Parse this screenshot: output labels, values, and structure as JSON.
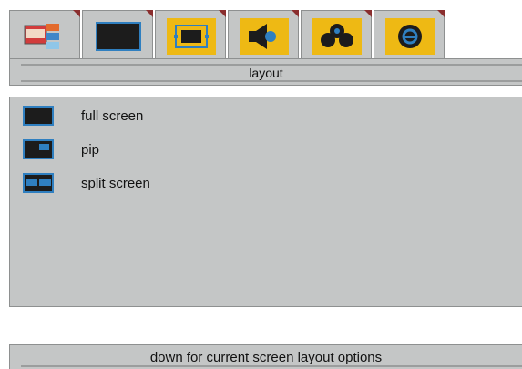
{
  "tabs": [
    {
      "icon": "picture-settings-icon",
      "yellow": false
    },
    {
      "icon": "screen-icon",
      "yellow": false
    },
    {
      "icon": "layout-icon",
      "yellow": true,
      "selected": true
    },
    {
      "icon": "audio-icon",
      "yellow": true
    },
    {
      "icon": "sources-icon",
      "yellow": true
    },
    {
      "icon": "setup-icon",
      "yellow": true
    }
  ],
  "title": "layout",
  "options": [
    {
      "label": "full screen",
      "icon": "full-screen-icon"
    },
    {
      "label": "pip",
      "icon": "pip-icon"
    },
    {
      "label": "split screen",
      "icon": "split-screen-icon"
    }
  ],
  "status_text": "down for current screen layout options",
  "colors": {
    "panel": "#c4c6c6",
    "border": "#8e9090",
    "accent_yellow": "#eeb914",
    "tab_corner": "#8a2e2e",
    "icon_blue": "#2f7fc0"
  }
}
